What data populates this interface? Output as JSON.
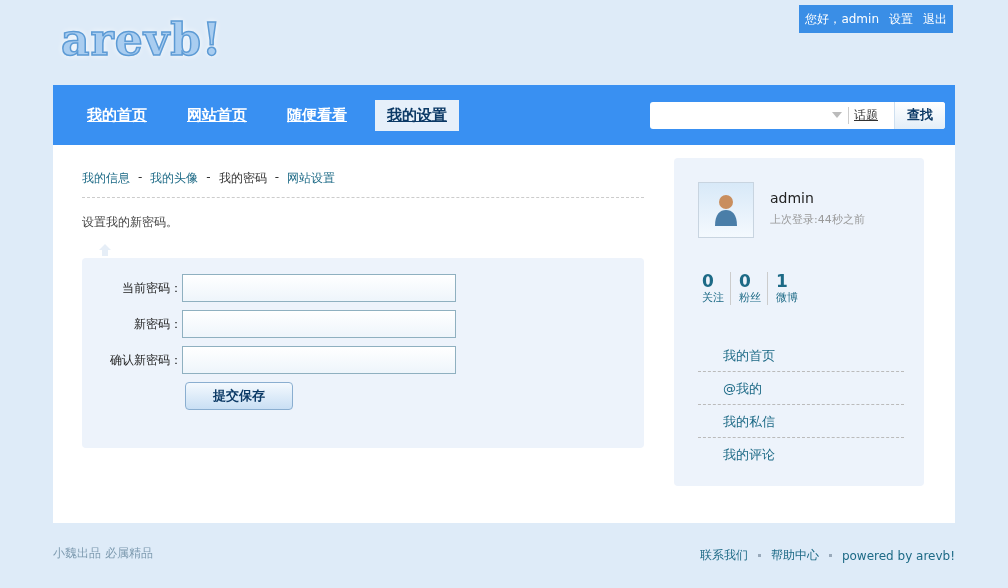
{
  "logo": "arevb!",
  "user_bar": {
    "greeting": "您好，admin",
    "links": [
      "设置",
      "退出"
    ]
  },
  "nav": [
    {
      "label": "我的首页",
      "selected": false
    },
    {
      "label": "网站首页",
      "selected": false
    },
    {
      "label": "随便看看",
      "selected": false
    },
    {
      "label": "我的设置",
      "selected": true
    }
  ],
  "search": {
    "scope": "话题",
    "button": "查找"
  },
  "subnav": [
    {
      "label": "我的信息",
      "selected": false
    },
    {
      "prefix": "-",
      "label": "我的头像",
      "selected": false
    },
    {
      "prefix": "-",
      "label": "我的密码",
      "selected": true
    },
    {
      "prefix": "-",
      "label": "网站设置",
      "selected": false
    }
  ],
  "intro": "设置我的新密码。",
  "form": {
    "fields": [
      {
        "label": "当前密码："
      },
      {
        "label": "新密码："
      },
      {
        "label": "确认新密码："
      }
    ],
    "submit": "提交保存"
  },
  "profile": {
    "name": "admin",
    "last_login": "上次登录:44秒之前",
    "stats": [
      {
        "count": "0",
        "label": "关注"
      },
      {
        "count": "0",
        "label": "粉丝"
      },
      {
        "count": "1",
        "label": "微博"
      }
    ],
    "menu": [
      "我的首页",
      "@我的",
      "我的私信",
      "我的评论"
    ]
  },
  "footer": {
    "left": "小魏出品 必属精品",
    "links": [
      "联系我们",
      "帮助中心",
      "powered by arevb!"
    ]
  }
}
